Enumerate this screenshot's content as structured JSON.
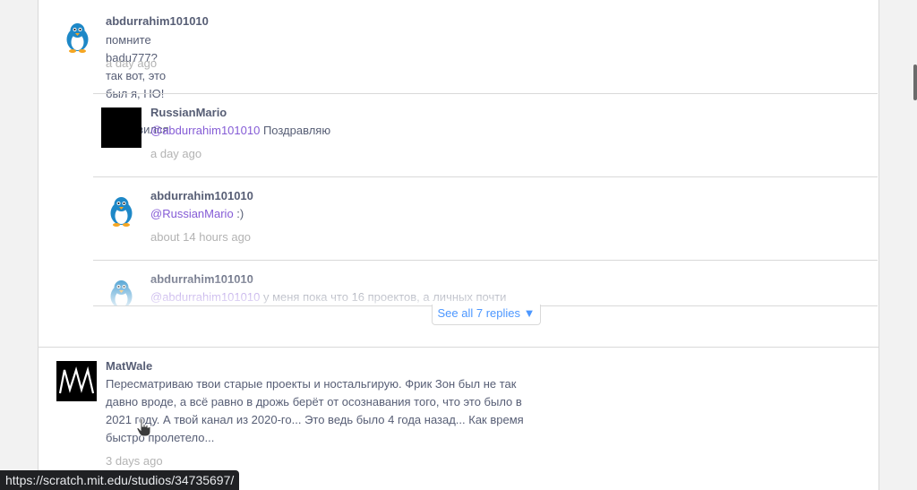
{
  "comments": {
    "c1": {
      "username": "abdurrahim101010",
      "text": "помните badu777? так вот, это был я, НО! я исправился",
      "time": "a day ago"
    },
    "r1": {
      "username": "RussianMario",
      "mention": "@abdurrahim101010",
      "text": " Поздравляю",
      "time": "a day ago"
    },
    "r2": {
      "username": "abdurrahim101010",
      "mention": "@RussianMario",
      "text": " :)",
      "time": "about 14 hours ago"
    },
    "r3": {
      "username": "abdurrahim101010",
      "mention": "@abdurrahim101010",
      "text": " у меня пока что 16 проектов, а личных почти"
    },
    "see_all": "See all 7 replies ▼",
    "c2": {
      "username": "MatWale",
      "text": "Пересматриваю твои старые проекты и ностальгирую. Фрик Зон был не так давно вроде, а всё равно в дрожь берёт от осознавания того, что это было в 2021 году. А твой канал из 2020-го... Это ведь было 4 года назад... Как время быстро пролетело...",
      "time": "3 days ago",
      "avatar_text": "MW"
    }
  },
  "status_bar": {
    "url": "https://scratch.mit.edu/studios/34735697/"
  },
  "colors": {
    "mention": "#855cd6",
    "link": "#4c97ff",
    "text": "#575e75",
    "muted": "#b3b3b3"
  },
  "icons": {
    "penguin_avatar": "penguin-avatar-icon",
    "cursor": "hand-pointer-icon"
  }
}
